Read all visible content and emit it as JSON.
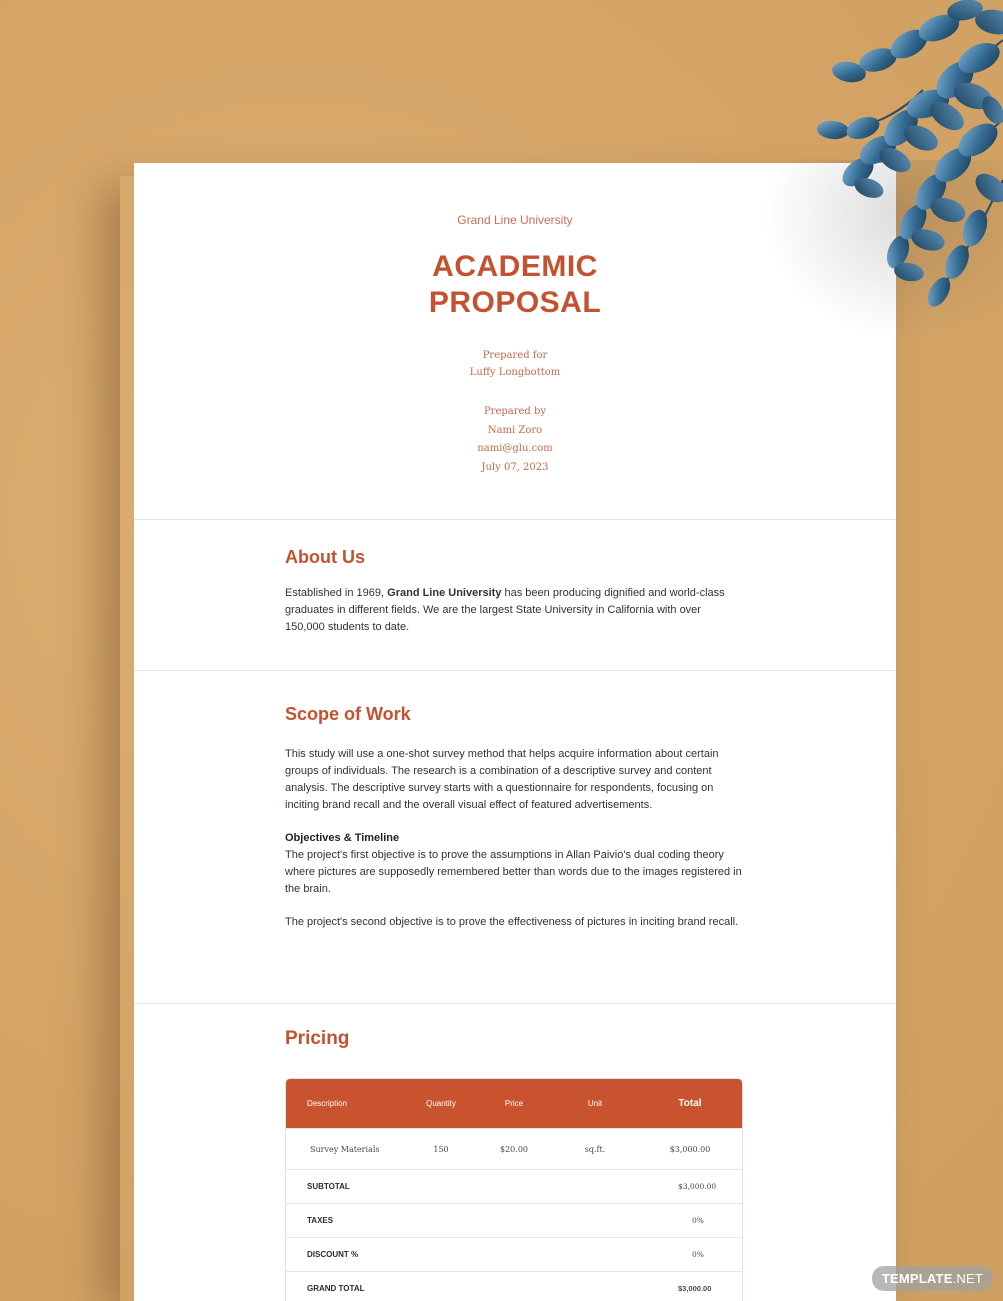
{
  "cover": {
    "university": "Grand Line University",
    "title_line1": "ACADEMIC",
    "title_line2": "PROPOSAL",
    "prepared_for_label": "Prepared for",
    "prepared_for_name": "Luffy Longbottom",
    "prepared_by_label": "Prepared by",
    "prepared_by_name": "Nami Zoro",
    "email": "nami@glu.com",
    "date": "July 07, 2023"
  },
  "about": {
    "heading": "About Us",
    "text_before": "Established in 1969, ",
    "text_bold": "Grand Line University",
    "text_after": " has been producing dignified and world-class graduates in different fields. We are the largest State University in California with over 150,000 students to date."
  },
  "scope": {
    "heading": "Scope of Work",
    "paragraph1": "This study will use a one-shot survey method that helps acquire information about certain groups of individuals. The research is a combination of a descriptive survey and content analysis. The descriptive survey starts with a questionnaire for respondents, focusing on inciting brand recall and the overall visual effect of featured advertisements.",
    "subheading": "Objectives & Timeline",
    "paragraph2": "The project's first objective is to prove the assumptions in Allan Paivio's dual coding theory where pictures are supposedly remembered better than words due to the images registered in the brain.",
    "paragraph3": "The project's second objective is to prove the effectiveness of pictures in inciting brand recall."
  },
  "pricing": {
    "heading": "Pricing",
    "headers": {
      "description": "Description",
      "quantity": "Quantity",
      "price": "Price",
      "unit": "Unit",
      "total": "Total"
    },
    "item": {
      "description": "Survey Materials",
      "quantity": "150",
      "price": "$20.00",
      "unit": "sq.ft.",
      "total": "$3,000.00"
    },
    "subtotal_label": "SUBTOTAL",
    "subtotal_value": "$3,000.00",
    "taxes_label": "TAXES",
    "taxes_value": "0%",
    "discount_label": "DISCOUNT %",
    "discount_value": "0%",
    "grand_total_label": "GRAND TOTAL",
    "grand_total_value": "$3,000.00"
  },
  "watermark": {
    "brand": "TEMPLATE",
    "suffix": ".NET"
  },
  "colors": {
    "accent": "#c4512f",
    "background": "#d7a86c"
  }
}
